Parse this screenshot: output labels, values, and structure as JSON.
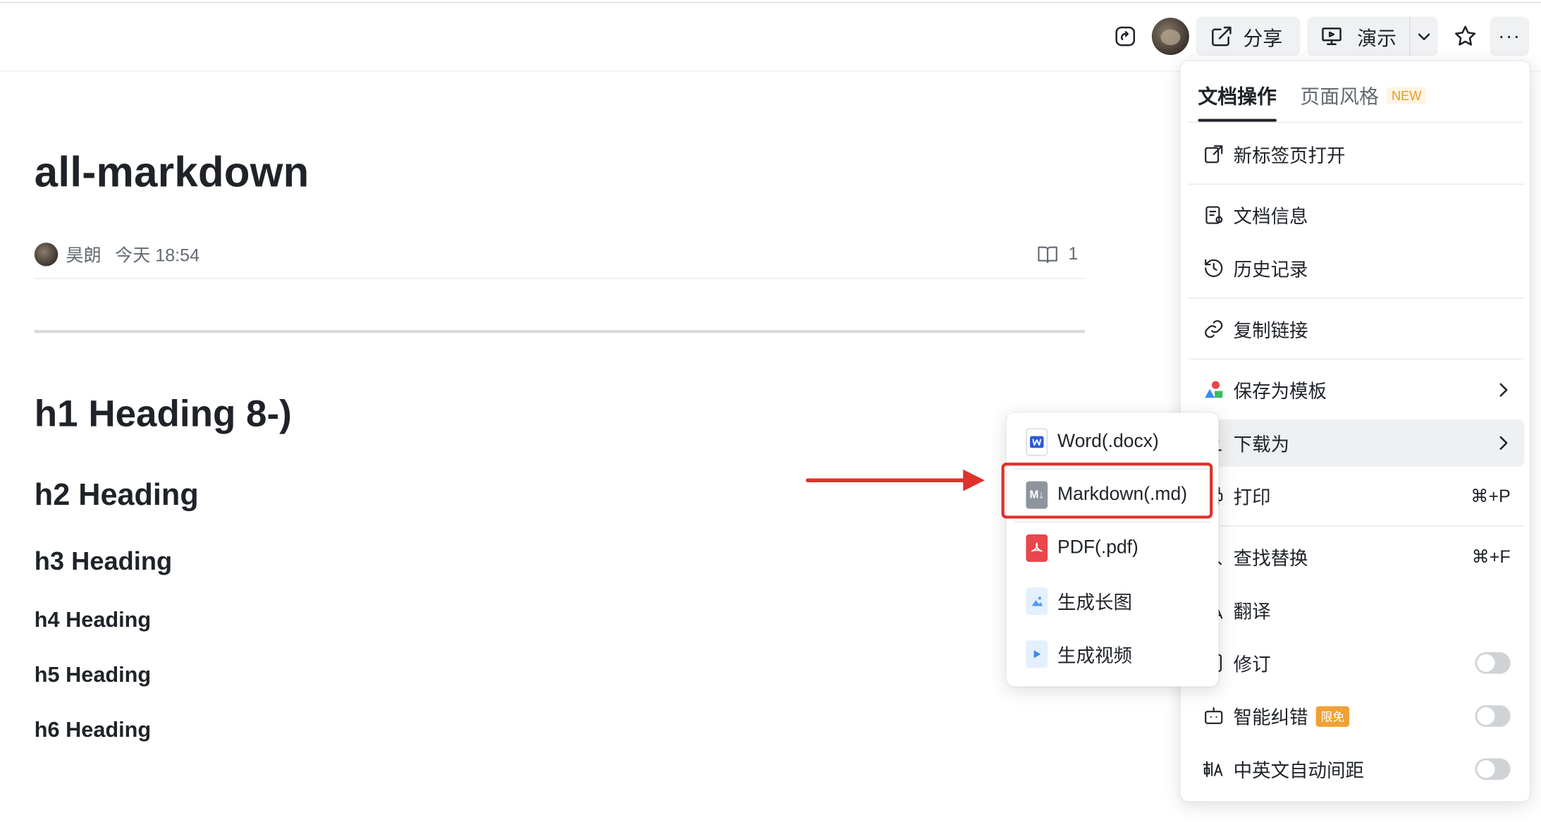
{
  "toolbar": {
    "share_label": "分享",
    "present_label": "演示",
    "more_label": "···"
  },
  "document": {
    "title": "all-markdown",
    "author": "昊朗",
    "updated": "今天 18:54",
    "read_count": "1",
    "headings": {
      "h1": "h1 Heading 8-)",
      "h2": "h2 Heading",
      "h3": "h3 Heading",
      "h4": "h4 Heading",
      "h5": "h5 Heading",
      "h6": "h6 Heading"
    }
  },
  "menu": {
    "tabs": [
      {
        "label": "文档操作",
        "active": true
      },
      {
        "label": "页面风格",
        "badge": "NEW"
      }
    ],
    "items": {
      "open_new_tab": "新标签页打开",
      "doc_info": "文档信息",
      "history": "历史记录",
      "copy_link": "复制链接",
      "save_template": "保存为模板",
      "download_as": "下载为",
      "print": "打印",
      "print_shortcut": "⌘+P",
      "find_replace": "查找替换",
      "find_shortcut": "⌘+F",
      "translate": "翻译",
      "revise": "修订",
      "smart_correct": "智能纠错",
      "smart_correct_badge": "限免",
      "auto_spacing": "中英文自动间距"
    }
  },
  "submenu": {
    "items": [
      {
        "label": "Word(.docx)",
        "icon": "word-file-icon"
      },
      {
        "label": "Markdown(.md)",
        "icon": "markdown-file-icon"
      },
      {
        "label": "PDF(.pdf)",
        "icon": "pdf-file-icon"
      },
      {
        "label": "生成长图",
        "icon": "image-file-icon"
      },
      {
        "label": "生成视频",
        "icon": "video-file-icon"
      }
    ]
  },
  "colors": {
    "annotation_red": "#e0312b",
    "word_blue": "#2b5cd6",
    "pdf_red": "#e8474b",
    "markdown_gray": "#8f959e",
    "image_blue": "#4c9bf5"
  }
}
